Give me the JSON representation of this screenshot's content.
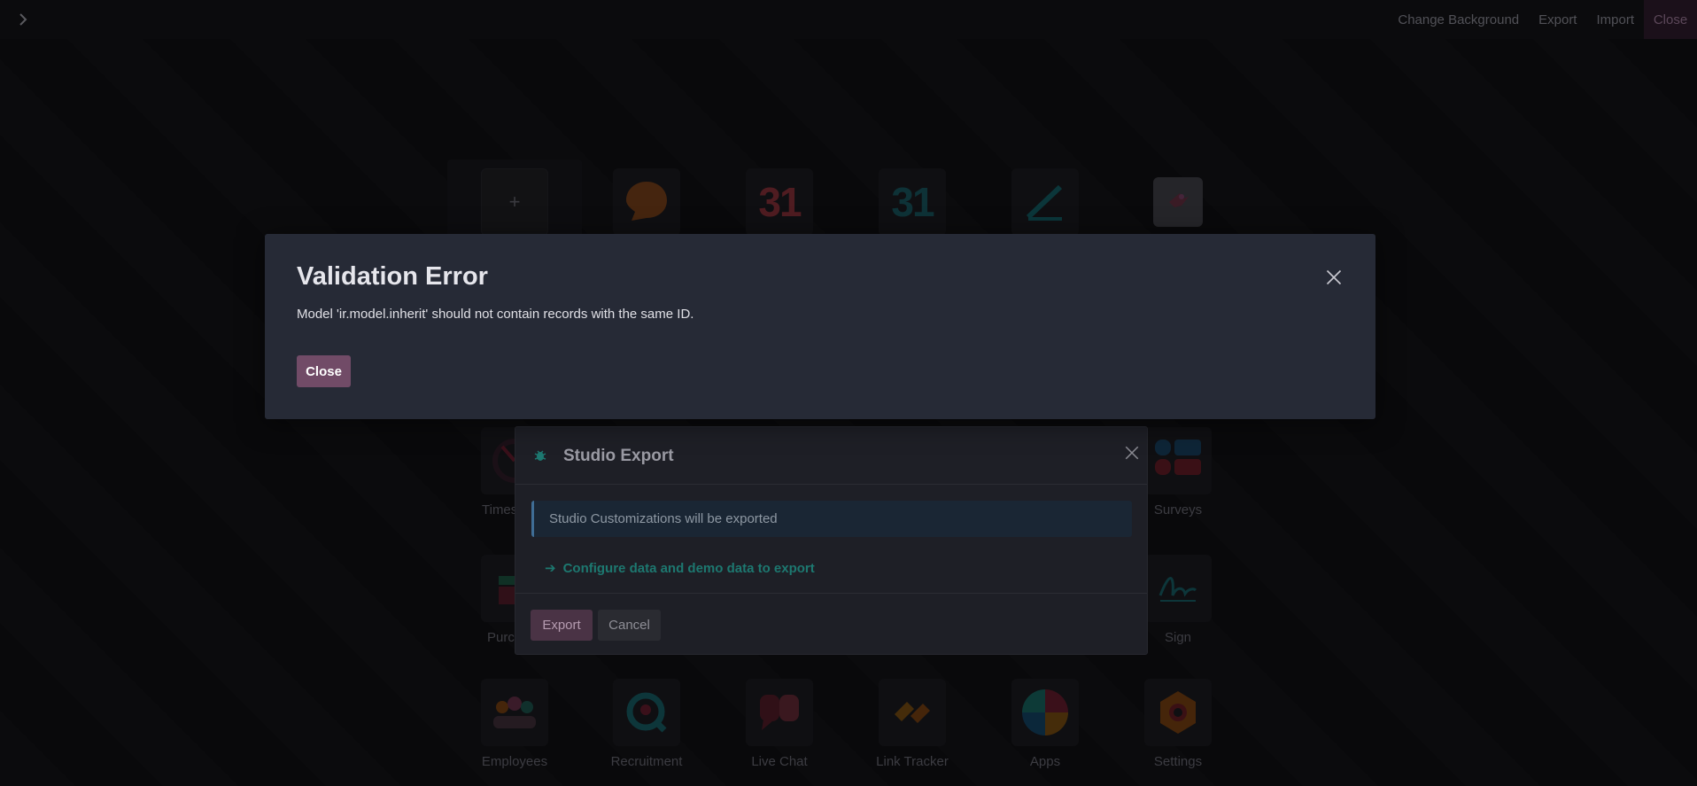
{
  "navbar": {
    "actions": {
      "change_background": "Change Background",
      "export": "Export",
      "import": "Import",
      "close": "Close"
    }
  },
  "apps": [
    {
      "id": "new",
      "name": ""
    },
    {
      "id": "discuss",
      "name": ""
    },
    {
      "id": "calendar",
      "name": ""
    },
    {
      "id": "to-do",
      "name": ""
    },
    {
      "id": "notes",
      "name": ""
    },
    {
      "id": "custom",
      "name": ""
    },
    {
      "id": "timesheets",
      "name": "Times"
    },
    {
      "id": "surveys",
      "name": "Surveys"
    },
    {
      "id": "purchase",
      "name": "Purc"
    },
    {
      "id": "sign",
      "name": "Sign"
    },
    {
      "id": "employees",
      "name": "Employees"
    },
    {
      "id": "recruitment",
      "name": "Recruitment"
    },
    {
      "id": "live-chat",
      "name": "Live Chat"
    },
    {
      "id": "link-tracker",
      "name": "Link Tracker"
    },
    {
      "id": "apps",
      "name": "Apps"
    },
    {
      "id": "settings",
      "name": "Settings"
    }
  ],
  "validation_dialog": {
    "title": "Validation Error",
    "message": "Model 'ir.model.inherit' should not contain records with the same ID.",
    "close_label": "Close"
  },
  "export_dialog": {
    "title": "Studio Export",
    "alert": "Studio Customizations will be exported",
    "config_link": "Configure data and demo data to export",
    "export_label": "Export",
    "cancel_label": "Cancel"
  },
  "colors": {
    "primary": "#714b67",
    "link": "#1d7870",
    "dialog_bg": "#262a36"
  }
}
